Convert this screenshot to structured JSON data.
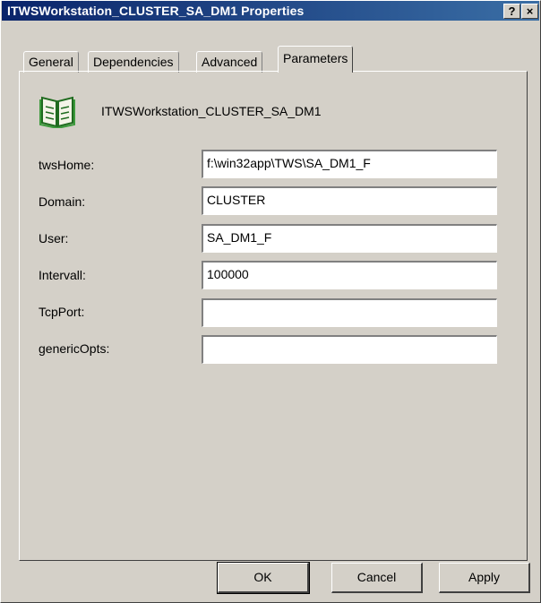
{
  "window": {
    "title": "ITWSWorkstation_CLUSTER_SA_DM1 Properties"
  },
  "titlebar": {
    "help_label": "?",
    "close_label": "×"
  },
  "tabs": [
    {
      "label": "General"
    },
    {
      "label": "Dependencies"
    },
    {
      "label": "Advanced"
    },
    {
      "label": "Parameters",
      "active": true
    }
  ],
  "header": {
    "name": "ITWSWorkstation_CLUSTER_SA_DM1",
    "icon": "book-icon"
  },
  "fields": [
    {
      "label": "twsHome:",
      "value": "f:\\win32app\\TWS\\SA_DM1_F"
    },
    {
      "label": "Domain:",
      "value": "CLUSTER"
    },
    {
      "label": "User:",
      "value": "SA_DM1_F"
    },
    {
      "label": "Intervall:",
      "value": "100000"
    },
    {
      "label": "TcpPort:",
      "value": ""
    },
    {
      "label": "genericOpts:",
      "value": ""
    }
  ],
  "buttons": {
    "ok": "OK",
    "cancel": "Cancel",
    "apply": "Apply"
  }
}
